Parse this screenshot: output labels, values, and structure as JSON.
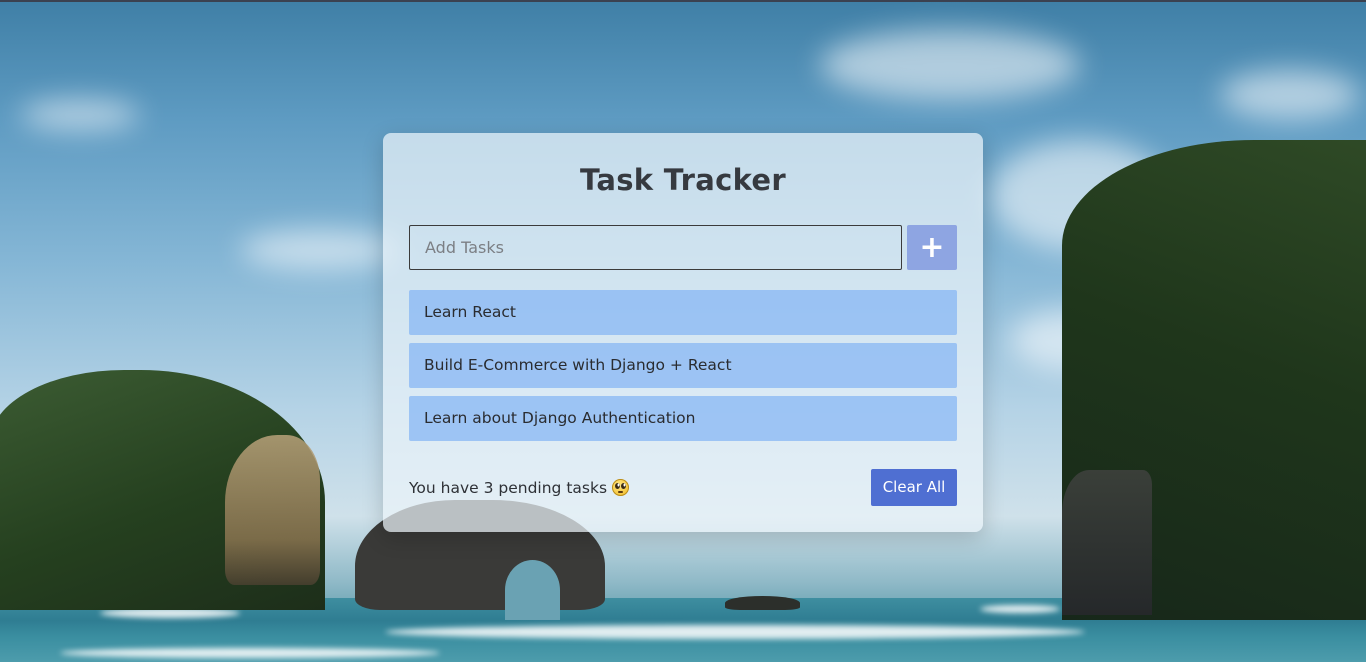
{
  "app": {
    "title": "Task Tracker"
  },
  "input": {
    "placeholder": "Add Tasks",
    "value": ""
  },
  "add_button": {
    "icon": "plus-icon",
    "label": "+"
  },
  "tasks": [
    {
      "label": "Learn React"
    },
    {
      "label": "Build E-Commerce with Django + React"
    },
    {
      "label": "Learn about Django Authentication"
    }
  ],
  "footer": {
    "pending_text": "You have 3 pending tasks",
    "pending_emoji": "rolling-eyes-emoji",
    "clear_label": "Clear All"
  },
  "colors": {
    "add_button": "#8ea5e2",
    "task_item": "#8ab8f4",
    "clear_button": "#4f6fd2",
    "title": "#363a40"
  }
}
